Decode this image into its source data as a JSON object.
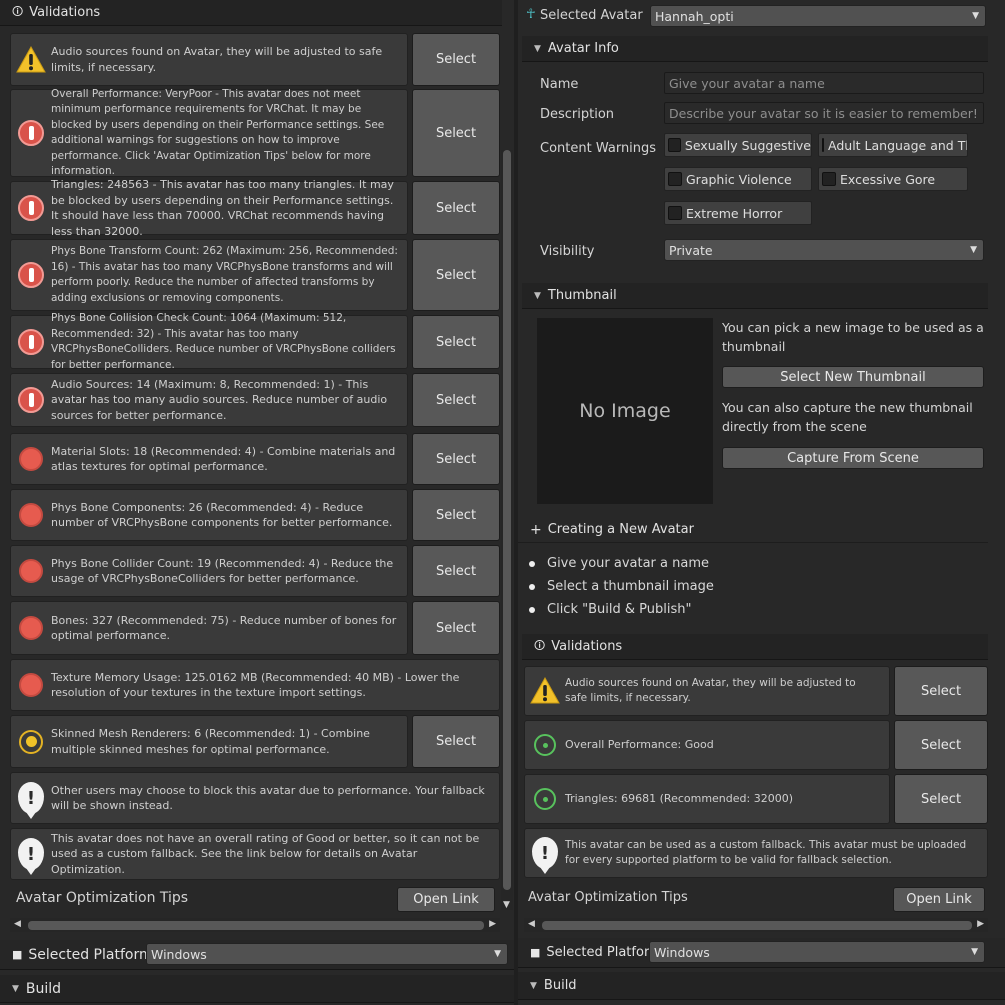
{
  "left": {
    "validations_title": "Validations",
    "items": [
      {
        "icon": "warning",
        "text": "Audio sources found on Avatar, they will be adjusted to safe limits, if necessary.",
        "button": "Select"
      },
      {
        "icon": "error",
        "text": "Overall Performance: VeryPoor - This avatar does not meet minimum performance requirements for VRChat. It may be blocked by users depending on their Performance settings. See additional warnings for suggestions on how to improve performance. Click 'Avatar Optimization Tips' below for more information.",
        "button": "Select"
      },
      {
        "icon": "error",
        "text": "Triangles: 248563 - This avatar has too many triangles. It may be blocked by users depending on their Performance settings. It should have less than 70000. VRChat recommends having less than 32000.",
        "button": "Select"
      },
      {
        "icon": "error",
        "text": "Phys Bone Transform Count: 262 (Maximum: 256, Recommended: 16) - This avatar has too many VRCPhysBone transforms and will perform poorly. Reduce the number of affected transforms by adding exclusions or removing components.",
        "button": "Select"
      },
      {
        "icon": "error",
        "text": "Phys Bone Collision Check Count: 1064 (Maximum: 512, Recommended: 32) - This avatar has too many VRCPhysBoneColliders. Reduce number of VRCPhysBone colliders for better performance.",
        "button": "Select"
      },
      {
        "icon": "error",
        "text": "Audio Sources: 14 (Maximum: 8, Recommended: 1) - This avatar has too many audio sources. Reduce number of audio sources for better performance.",
        "button": "Select"
      },
      {
        "icon": "poor",
        "text": "Material Slots: 18 (Recommended: 4) - Combine materials and atlas textures for optimal performance.",
        "button": "Select"
      },
      {
        "icon": "poor",
        "text": "Phys Bone Components: 26 (Recommended: 4) - Reduce number of VRCPhysBone components for better performance.",
        "button": "Select"
      },
      {
        "icon": "poor",
        "text": "Phys Bone Collider Count: 19 (Recommended: 4) - Reduce the usage of VRCPhysBoneColliders for better performance.",
        "button": "Select"
      },
      {
        "icon": "poor",
        "text": "Bones: 327 (Recommended: 75) - Reduce number of bones for optimal performance.",
        "button": "Select"
      },
      {
        "icon": "poor",
        "text": "Texture Memory Usage: 125.0162 MB (Recommended: 40 MB) - Lower the resolution of your textures in the texture import settings.",
        "button": ""
      },
      {
        "icon": "medium",
        "text": "Skinned Mesh Renderers: 6 (Recommended: 1) - Combine multiple skinned meshes for optimal performance.",
        "button": "Select"
      },
      {
        "icon": "info",
        "text": "Other users may choose to block this avatar due to performance. Your fallback will be shown instead.",
        "button": ""
      },
      {
        "icon": "info",
        "text": "This avatar does not have an overall rating of Good or better, so it can not be used as a custom fallback. See the link below for details on Avatar Optimization.",
        "button": ""
      }
    ],
    "tips_label": "Avatar Optimization Tips",
    "open_link": "Open Link",
    "platform_label": "Selected Platform",
    "platform_value": "Windows",
    "build_title": "Build"
  },
  "right": {
    "selected_avatar_label": "Selected Avatar",
    "selected_avatar_value": "Hannah_opti",
    "avatar_info_title": "Avatar Info",
    "name_label": "Name",
    "name_placeholder": "Give your avatar a name",
    "description_label": "Description",
    "description_placeholder": "Describe your avatar so it is easier to remember!",
    "content_warnings_label": "Content Warnings",
    "warnings": [
      "Sexually Suggestive",
      "Adult Language and Them",
      "Graphic Violence",
      "Excessive Gore",
      "Extreme Horror"
    ],
    "visibility_label": "Visibility",
    "visibility_value": "Private",
    "thumbnail_title": "Thumbnail",
    "no_image": "No Image",
    "thumb_text1": "You can pick a new image to be used as a thumbnail",
    "select_thumb_button": "Select New Thumbnail",
    "thumb_text2": "You can also capture the new thumbnail directly from the scene",
    "capture_button": "Capture From Scene",
    "creating_title": "Creating a New Avatar",
    "steps": [
      "Give your avatar a name",
      "Select a thumbnail image",
      "Click \"Build & Publish\""
    ],
    "validations_title": "Validations",
    "items": [
      {
        "icon": "warning",
        "text": "Audio sources found on Avatar, they will be adjusted to safe limits, if necessary.",
        "button": "Select"
      },
      {
        "icon": "good",
        "text": "Overall Performance: Good",
        "button": "Select"
      },
      {
        "icon": "good",
        "text": "Triangles: 69681 (Recommended: 32000)",
        "button": "Select"
      },
      {
        "icon": "info",
        "text": "This avatar can be used as a custom fallback. This avatar must be uploaded for every supported platform to be valid for fallback selection.",
        "button": ""
      }
    ],
    "tips_label": "Avatar Optimization Tips",
    "open_link": "Open Link",
    "platform_label": "Selected Platform",
    "platform_value": "Windows",
    "build_title": "Build"
  }
}
